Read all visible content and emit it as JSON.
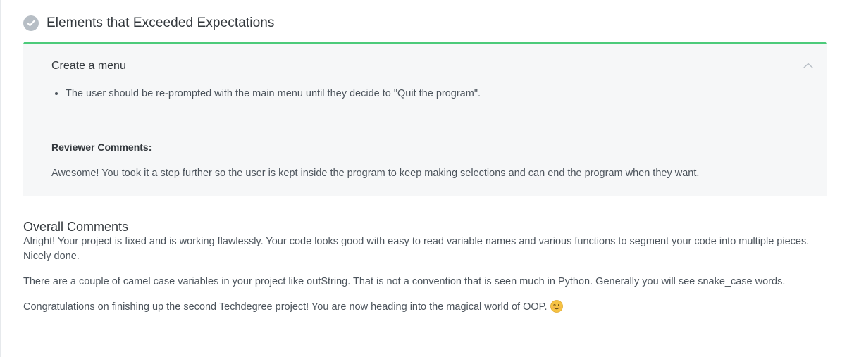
{
  "section": {
    "title": "Elements that Exceeded Expectations",
    "icon": "check-circle-icon"
  },
  "criteria": {
    "title": "Create a menu",
    "toggle_icon": "chevron-up-icon",
    "items": [
      "The user should be re-prompted with the main menu until they decide to \"Quit the program\"."
    ],
    "reviewer_label": "Reviewer Comments:",
    "reviewer_comment": "Awesome! You took it a step further so the user is kept inside the program to keep making selections and can end the program when they want."
  },
  "overall": {
    "title": "Overall Comments",
    "paragraphs": [
      "Alright! Your project is fixed and is working flawlessly. Your code looks good with easy to read variable names and various functions to segment your code into multiple pieces. Nicely done.",
      "There are a couple of camel case variables in your project like outString. That is not a convention that is seen much in Python. Generally you will see snake_case words.",
      "Congratulations on finishing up the second Techdegree project! You are now heading into the magical world of OOP."
    ],
    "emoji": "wink-emoji-icon"
  },
  "colors": {
    "accent_green": "#4ccb7a",
    "check_gray": "#b7bec5",
    "card_bg": "#f6f7f8",
    "text_dark": "#33383d",
    "text_body": "#4c545c"
  }
}
